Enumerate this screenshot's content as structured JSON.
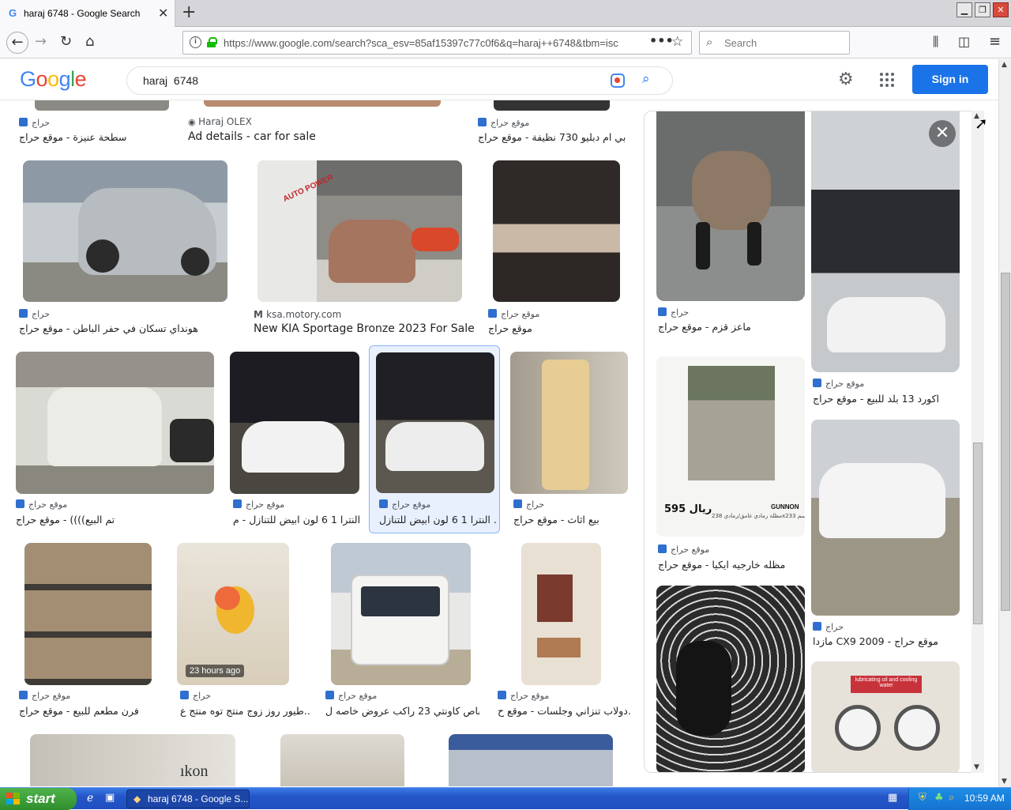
{
  "browser": {
    "tab_title": "haraj 6748 - Google Search",
    "tab_favicon": "G",
    "new_tab_glyph": "+",
    "url": "https://www.google.com/search?sca_esv=85af15397c77c0f6&q=haraj++6748&tbm=isc",
    "search_placeholder": "Search"
  },
  "google": {
    "logo_letters": [
      "G",
      "o",
      "o",
      "g",
      "l",
      "e"
    ],
    "logo_colors": [
      "#4285f4",
      "#ea4335",
      "#fbbc05",
      "#4285f4",
      "#34a853",
      "#ea4335"
    ],
    "query": "haraj  6748",
    "signin_label": "Sign in"
  },
  "results": [
    {
      "source": "حراج",
      "title": "سطحة عنيزة - موقع حراج"
    },
    {
      "source": "Haraj OLEX",
      "title": "Ad details - car for sale"
    },
    {
      "source": "موقع حراج",
      "title": "بي ام دبليو 730 نظيفة - موقع حراج"
    },
    {
      "source": "حراج",
      "title": "هونداي تسكان في حفر الباطن - موقع حراج"
    },
    {
      "source": "ksa.motory.com",
      "title": "New KIA Sportage Bronze 2023 For Sale ..."
    },
    {
      "source": "موقع حراج",
      "title": "موقع حراج"
    },
    {
      "source": "موقع حراج",
      "title": "تم البيع)))) - موقع حراج"
    },
    {
      "source": "موقع حراج",
      "title": "النترا 1 6 لون ابيض للتنازل - م..."
    },
    {
      "source": "موقع حراج",
      "title": "النترا 1 6 لون ابيض للتنازل ..."
    },
    {
      "source": "حراج",
      "title": "بيع اثاث - موقع حراج"
    },
    {
      "source": "موقع حراج",
      "title": "فرن مطعم للبيع - موقع حراج"
    },
    {
      "source": "حراج",
      "title": "طيور روز زوج منتج توه منتج ع..."
    },
    {
      "source": "موقع حراج",
      "title": "باص كاونتي 23 راكب عروض خاصه ل..."
    },
    {
      "source": "موقع حراج",
      "title": "دولاب تنزاني وجلسات - موقع ح..."
    }
  ],
  "parrot_badge": "23 hours ago",
  "kia_overlay": "AUTO POWER",
  "related": [
    {
      "source": "حراج",
      "title": "ماعز قزم - موقع حراج"
    },
    {
      "source": "موقع حراج",
      "title": "اكورد 13 بلد للبيع - موقع حراج"
    },
    {
      "source": "موقع حراج",
      "title": "مظله خارجيه ايكيا - موقع حراج"
    },
    {
      "source": "حراج",
      "title": "مازدا CX9 2009 - موقع حراج"
    }
  ],
  "gazebo_ad": {
    "price": "595 ريال",
    "brand": "GUNNON",
    "desc": "مظلة رمادي غامق/رمادي 238x233 سم"
  },
  "gauge_label": "lubricating oil and cooling water",
  "taskbar": {
    "start_label": "start",
    "task_label": "haraj 6748 - Google S...",
    "clock": "10:59 AM"
  }
}
